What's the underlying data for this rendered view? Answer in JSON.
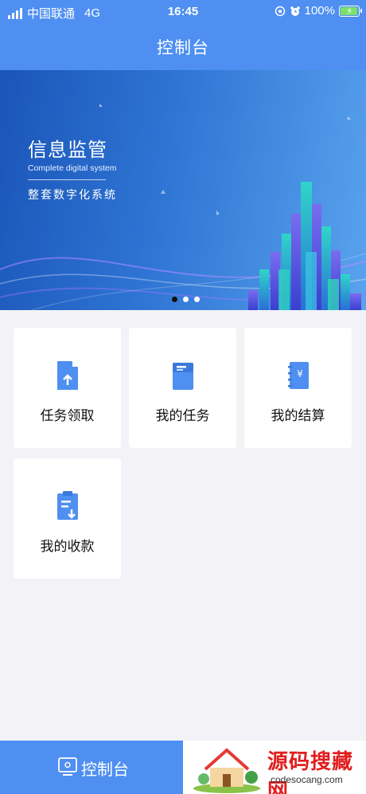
{
  "status_bar": {
    "carrier": "中国联通",
    "network": "4G",
    "time": "16:45",
    "battery_pct": "100%",
    "battery_color": "#7ce06d"
  },
  "header": {
    "title": "控制台",
    "bg_color": "#4e8ff1"
  },
  "banner": {
    "title": "信息监管",
    "subtitle": "Complete digital system",
    "description": "整套数字化系统",
    "slides": 3,
    "active_slide": 0
  },
  "menu": {
    "items": [
      {
        "label": "任务领取",
        "icon": "task-claim-icon"
      },
      {
        "label": "我的任务",
        "icon": "my-task-icon"
      },
      {
        "label": "我的结算",
        "icon": "settlement-icon"
      },
      {
        "label": "我的收款",
        "icon": "receipt-icon"
      }
    ],
    "icon_color": "#4e8ff1"
  },
  "tabbar": {
    "active_label": "控制台",
    "watermark_text": "源码搜藏网",
    "watermark_url": "codesocang.com"
  }
}
